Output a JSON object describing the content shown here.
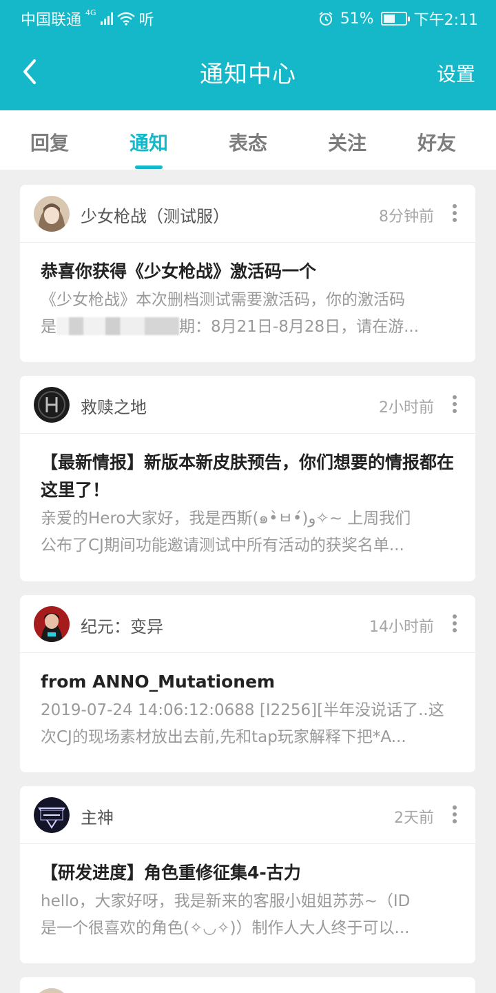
{
  "status_bar": {
    "carrier": "中国联通",
    "network": "4G",
    "extra": "听",
    "battery_percent": "51%",
    "time": "下午2:11"
  },
  "header": {
    "title": "通知中心",
    "settings_label": "设置",
    "bg_color": "#15b8c8"
  },
  "tabs": [
    {
      "label": "回复"
    },
    {
      "label": "通知",
      "active": true
    },
    {
      "label": "表态"
    },
    {
      "label": "关注"
    },
    {
      "label": "好友"
    }
  ],
  "notifications": [
    {
      "author": "少女枪战（测试服）",
      "time": "8分钟前",
      "title": "恭喜你获得《少女枪战》激活码一个",
      "line1": "《少女枪战》本次删档测试需要激活码，你的激活码",
      "line2_pre": "是",
      "line2_post": "期：8月21日-8月28日，请在游..."
    },
    {
      "author": "救赎之地",
      "time": "2小时前",
      "title": "【最新情报】新版本新皮肤预告，你们想要的情报都在这里了！",
      "line1": "亲爱的Hero大家好，我是西斯(๑•̀ㅂ•́)و✧~ 上周我们",
      "line2": "公布了CJ期间功能邀请测试中所有活动的获奖名单..."
    },
    {
      "author": "纪元：变异",
      "time": "14小时前",
      "title": "from ANNO_Mutationem",
      "line1": "2019-07-24 14:06:12:0688 [I2256][半年没说话了..这",
      "line2": "次CJ的现场素材放出去前,先和tap玩家解释下把*A..."
    },
    {
      "author": "主神",
      "time": "2天前",
      "title": "【研发进度】角色重修征集4-古力",
      "line1": "hello，大家好呀，我是新来的客服小姐姐苏苏~（ID",
      "line2": "是一个很喜欢的角色(✧◡✧)）制作人大人终于可以..."
    }
  ]
}
